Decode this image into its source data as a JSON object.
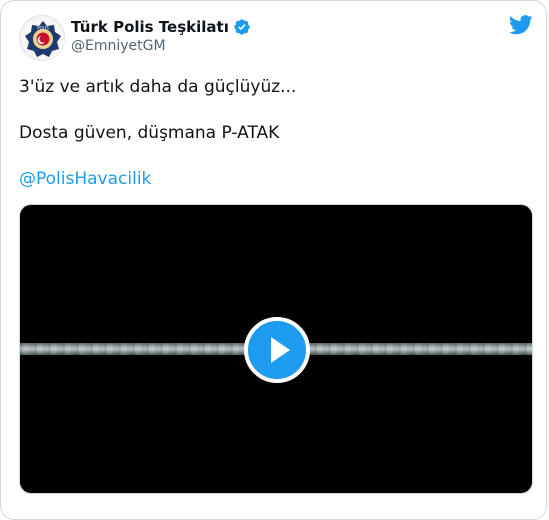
{
  "author": {
    "display_name": "Türk Polis Teşkilatı",
    "handle": "@EmniyetGM",
    "avatar_icon": "police-badge-icon",
    "verified_icon": "verified-badge-icon",
    "verified_color": "#1d9bf0"
  },
  "brand": {
    "logo_icon": "twitter-bird-icon",
    "color": "#1d9bf0"
  },
  "tweet": {
    "line1": "3'üz ve artık daha da güçlüyüz...",
    "line2": "Dosta güven, düşmana P-ATAK",
    "mention": "@PolisHavacilik"
  },
  "media": {
    "type": "video",
    "play_icon": "play-icon",
    "accent": "#1d9bf0"
  }
}
